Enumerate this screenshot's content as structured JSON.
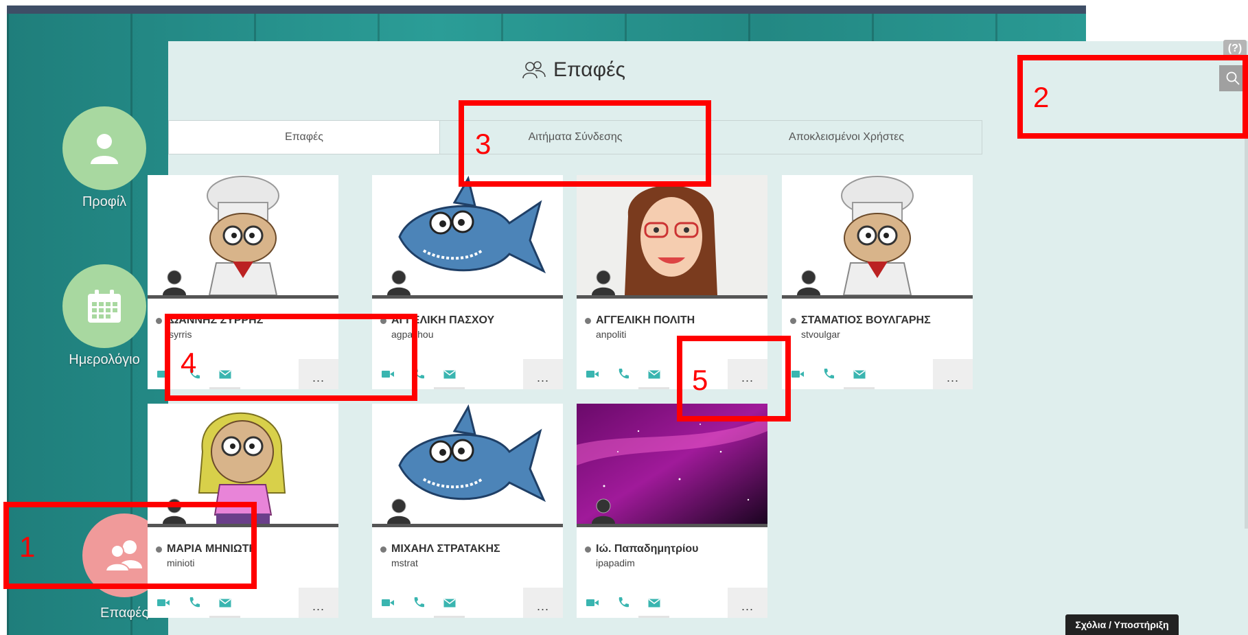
{
  "nav": {
    "items": [
      {
        "label": "Προφίλ",
        "icon": "user-icon",
        "color": "#a8d8a0"
      },
      {
        "label": "Ημερολόγιο",
        "icon": "calendar-icon",
        "color": "#a8d8a0"
      },
      {
        "label": "Επαφές",
        "icon": "contacts-icon",
        "color": "#f09a9a"
      }
    ]
  },
  "page": {
    "title": "Επαφές",
    "title_icon": "contacts-icon"
  },
  "tabs": [
    {
      "label": "Επαφές",
      "active": true
    },
    {
      "label": "Αιτήματα Σύνδεσης",
      "active": false
    },
    {
      "label": "Αποκλεισμένοι Χρήστες",
      "active": false
    }
  ],
  "contacts": [
    {
      "name": "ΙΩΑΝΝΗΣ ΣΥΡΡΗΣ",
      "username": "isyrris",
      "avatar": "chef"
    },
    {
      "name": "ΑΓΓΕΛΙΚΗ ΠΑΣΧΟΥ",
      "username": "agpashou",
      "avatar": "shark"
    },
    {
      "name": "ΑΓΓΕΛΙΚΗ ΠΟΛΙΤΗ",
      "username": "anpoliti",
      "avatar": "woman"
    },
    {
      "name": "ΣΤΑΜΑΤΙΟΣ ΒΟΥΛΓΑΡΗΣ",
      "username": "stvoulgar",
      "avatar": "chef"
    },
    {
      "name": "ΜΑΡΙΑ ΜΗΝΙΩΤΗ",
      "username": "minioti",
      "avatar": "girl"
    },
    {
      "name": "ΜΙΧΑΗΛ ΣΤΡΑΤΑΚΗΣ",
      "username": "mstrat",
      "avatar": "shark"
    },
    {
      "name": "Ιώ. Παπαδημητρίου",
      "username": "ipapadim",
      "avatar": "space"
    }
  ],
  "card_actions": {
    "video": "video-icon",
    "phone": "phone-icon",
    "mail": "mail-icon",
    "more": "..."
  },
  "toolbar": {
    "help": "(?)",
    "search_icon": "search-icon"
  },
  "support_label": "Σχόλια / Υποστήριξη",
  "annotations": [
    {
      "number": "1"
    },
    {
      "number": "2"
    },
    {
      "number": "3"
    },
    {
      "number": "4"
    },
    {
      "number": "5"
    }
  ],
  "colors": {
    "accent": "#3ab5b0",
    "annotation": "#ff0000",
    "panel": "#dfeeed"
  }
}
